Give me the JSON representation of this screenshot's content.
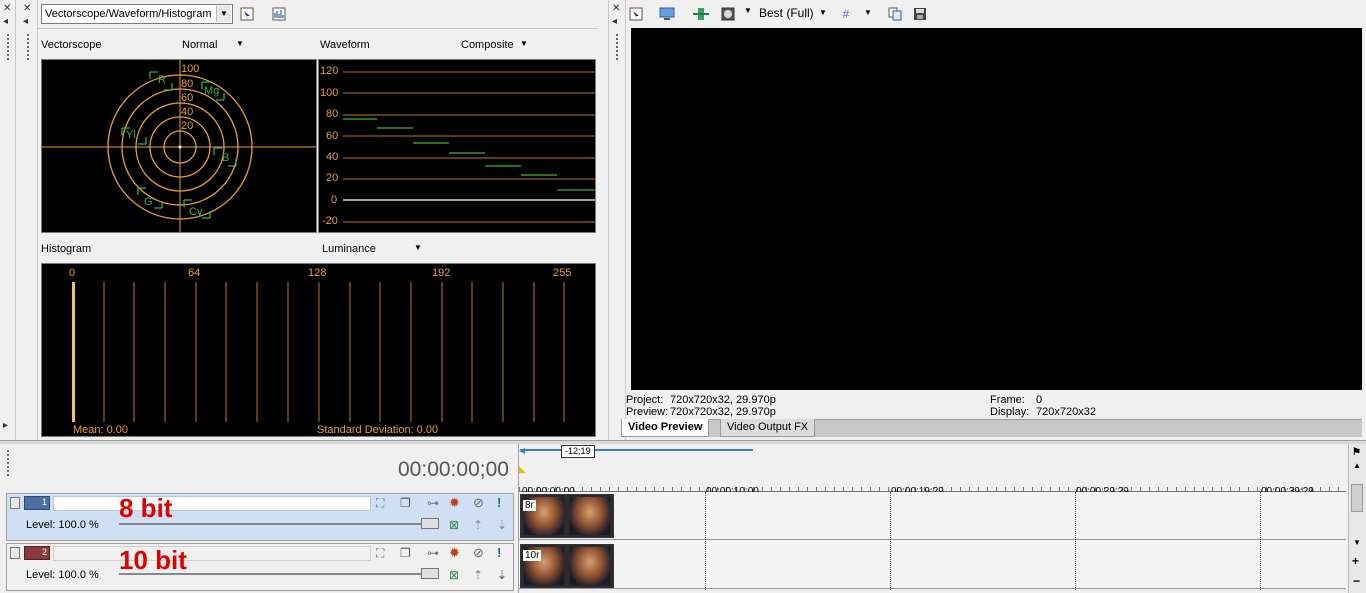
{
  "scopes": {
    "mode_select": "Vectorscope/Waveform/Histogram",
    "vectorscope": {
      "title": "Vectorscope",
      "mode": "Normal",
      "ring_labels": [
        "100",
        "80",
        "60",
        "40",
        "20"
      ],
      "targets": [
        "R",
        "Mg",
        "Yl",
        "B",
        "G",
        "Cy"
      ]
    },
    "waveform": {
      "title": "Waveform",
      "mode": "Composite",
      "y_labels": [
        "120",
        "100",
        "80",
        "60",
        "40",
        "20",
        "0",
        "-20"
      ]
    },
    "histogram": {
      "title": "Histogram",
      "mode": "Luminance",
      "x_labels": [
        "0",
        "64",
        "128",
        "192",
        "255"
      ],
      "mean": "Mean: 0.00",
      "std": "Standard Deviation: 0.00"
    }
  },
  "preview": {
    "quality": "Best (Full)",
    "project_label": "Project:",
    "project_value": "720x720x32, 29.970p",
    "preview_label": "Preview:",
    "preview_value": "720x720x32, 29.970p",
    "frame_label": "Frame:",
    "frame_value": "0",
    "display_label": "Display:",
    "display_value": "720x720x32",
    "tabs": [
      "Video Preview",
      "Video Output FX"
    ]
  },
  "timeline": {
    "timecode": "00:00:00;00",
    "region_length": "-12;19",
    "ruler": [
      "00:00:00;00",
      "00:00:10;00",
      "00:00:19;29",
      "00:00:29;29",
      "00:00:39;29"
    ],
    "tracks": [
      {
        "number": "1",
        "level": "Level: 100.0 %",
        "overlay": "8 bit",
        "clip_label": "8r"
      },
      {
        "number": "2",
        "level": "Level: 100.0 %",
        "overlay": "10 bit",
        "clip_label": "10r"
      }
    ]
  },
  "colors": {
    "scope_orange": "#e8a030",
    "scope_green": "#40b040",
    "overlay_red": "#e00000",
    "track1_bg": "#cfe0f5",
    "track2_bg": "#f0f0f0"
  },
  "icons": [
    "close-icon",
    "pin-icon",
    "select-icon",
    "histogram-icon",
    "monitor-icon",
    "split-icon",
    "overlay-icon",
    "grid-icon",
    "copy-icon",
    "save-icon",
    "track-fx-icon",
    "mute-icon",
    "solo-icon",
    "play-cursor-icon"
  ]
}
